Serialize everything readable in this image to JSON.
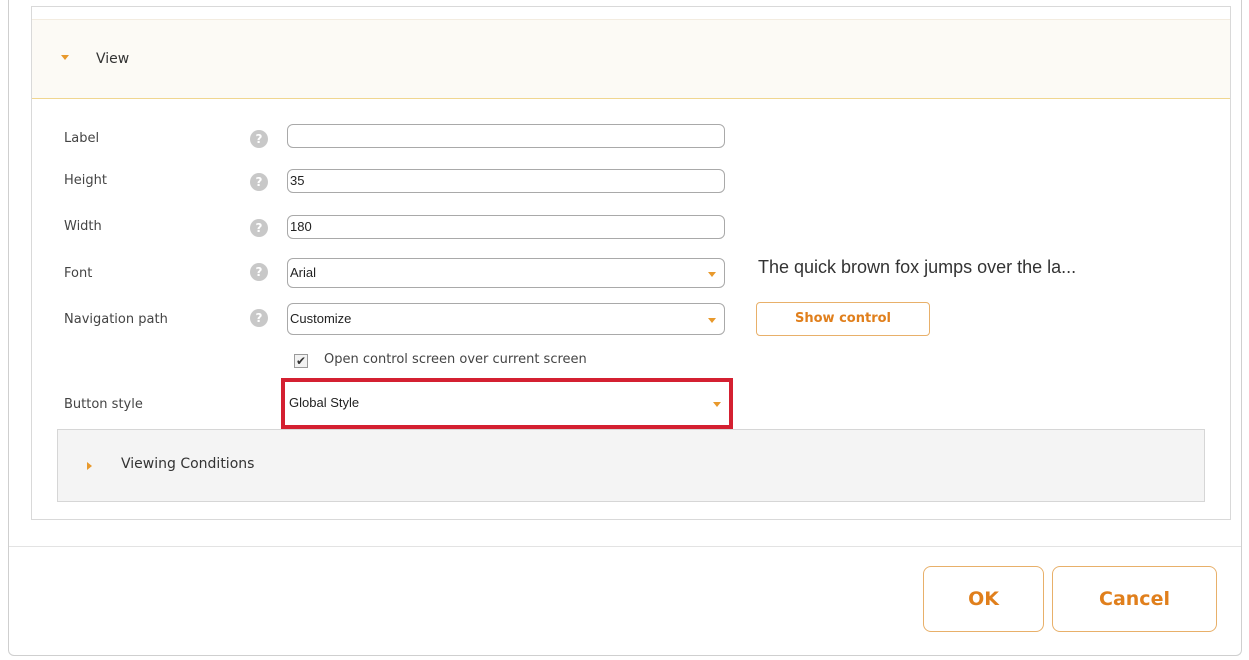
{
  "view": {
    "title": "View"
  },
  "form": {
    "label": {
      "label": "Label",
      "help": "?",
      "value": ""
    },
    "height": {
      "label": "Height",
      "help": "?",
      "value": "35"
    },
    "width": {
      "label": "Width",
      "help": "?",
      "value": "180"
    },
    "font": {
      "label": "Font",
      "help": "?",
      "value": "Arial"
    },
    "navigation_path": {
      "label": "Navigation path",
      "help": "?",
      "value": "Customize"
    },
    "open_over": {
      "checked": true,
      "check_glyph": "✔",
      "label": "Open control screen over current screen"
    },
    "button_style": {
      "label": "Button style",
      "value": "Global Style"
    }
  },
  "preview": {
    "text": "The quick brown fox jumps over the la...",
    "show_control_label": "Show control"
  },
  "viewing_conditions": {
    "title": "Viewing Conditions"
  },
  "footer": {
    "ok_label": "OK",
    "cancel_label": "Cancel"
  },
  "colors": {
    "accent": "#e07f1c",
    "highlight": "#d42031"
  }
}
